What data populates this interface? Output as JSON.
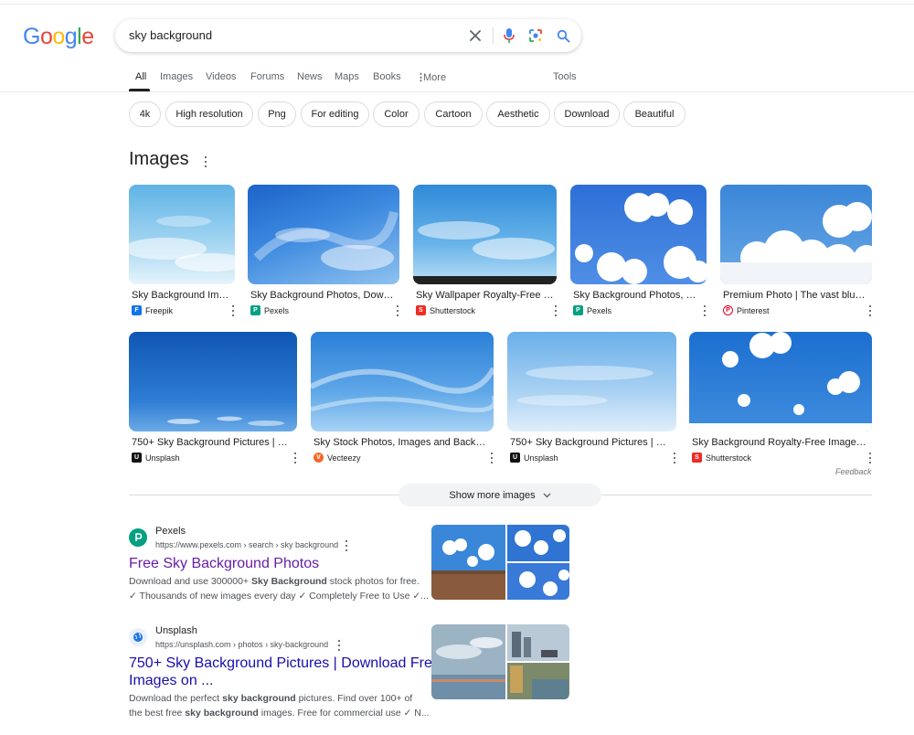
{
  "logo": {
    "letters": [
      "G",
      "o",
      "o",
      "g",
      "l",
      "e"
    ],
    "colors": [
      "#4285f4",
      "#ea4335",
      "#fbbc05",
      "#4285f4",
      "#34a853",
      "#ea4335"
    ]
  },
  "search": {
    "query": "sky background",
    "icons": [
      "close-icon",
      "microphone-icon",
      "lens-icon",
      "search-icon"
    ]
  },
  "tabs": [
    {
      "label": "All",
      "active": true
    },
    {
      "label": "Images"
    },
    {
      "label": "Videos"
    },
    {
      "label": "Forums"
    },
    {
      "label": "News"
    },
    {
      "label": "Maps"
    },
    {
      "label": "Books"
    },
    {
      "label": "More"
    },
    {
      "label": "Tools"
    }
  ],
  "chips": [
    "4k",
    "High resolution",
    "Png",
    "For editing",
    "Color",
    "Cartoon",
    "Aesthetic",
    "Download",
    "Beautiful"
  ],
  "images_section": {
    "heading": "Images",
    "row1": [
      {
        "caption": "Sky Background Imag...",
        "source": "Freepik",
        "fav": "F",
        "fav_color": "#1273eb"
      },
      {
        "caption": "Sky Background Photos, Downlo...",
        "source": "Pexels",
        "fav": "P",
        "fav_color": "#05a081"
      },
      {
        "caption": "Sky Wallpaper Royalty-Free Im...",
        "source": "Shutterstock",
        "fav": "S",
        "fav_color": "#ee2b24"
      },
      {
        "caption": "Sky Background Photos, Do...",
        "source": "Pexels",
        "fav": "P",
        "fav_color": "#05a081"
      },
      {
        "caption": "Premium Photo | The vast blue sk...",
        "source": "Pinterest",
        "fav": "P",
        "fav_color": "#e60023"
      }
    ],
    "row2": [
      {
        "caption": "750+ Sky Background Pictures | Dow...",
        "source": "Unsplash",
        "fav": "U",
        "fav_color": "#111111"
      },
      {
        "caption": "Sky Stock Photos, Images and Backgrou...",
        "source": "Vecteezy",
        "fav": "V",
        "fav_color": "#f26a2b"
      },
      {
        "caption": "750+ Sky Background Pictures | Dow...",
        "source": "Unsplash",
        "fav": "U",
        "fav_color": "#111111"
      },
      {
        "caption": "Sky Background Royalty-Free Images, S...",
        "source": "Shutterstock",
        "fav": "S",
        "fav_color": "#ee2b24"
      }
    ],
    "feedback": "Feedback",
    "show_more": "Show more images"
  },
  "results": [
    {
      "site": "Pexels",
      "url": "https://www.pexels.com › search › sky background",
      "title": "Free Sky Background Photos",
      "snippet_line1_pre": "Download and use 300000+ ",
      "snippet_line1_bold": "Sky Background",
      "snippet_line1_post": " stock photos for free.",
      "snippet_line2": "✓ Thousands of new images every day ✓ Completely Free to Use ✓...",
      "fav_color": "#05a081"
    },
    {
      "site": "Unsplash",
      "url": "https://unsplash.com › photos › sky-background",
      "title_line1": "750+ Sky Background Pictures | Download Free",
      "title_line2": "Images on ...",
      "snippet_line1_pre": "Download the perfect ",
      "snippet_line1_bold": "sky background",
      "snippet_line1_post": " pictures. Find over 100+ of",
      "snippet_line2_pre": "the best free ",
      "snippet_line2_bold": "sky background",
      "snippet_line2_post": " images. Free for commercial use ✓ N...",
      "fav_color": "#1a73e8"
    }
  ]
}
